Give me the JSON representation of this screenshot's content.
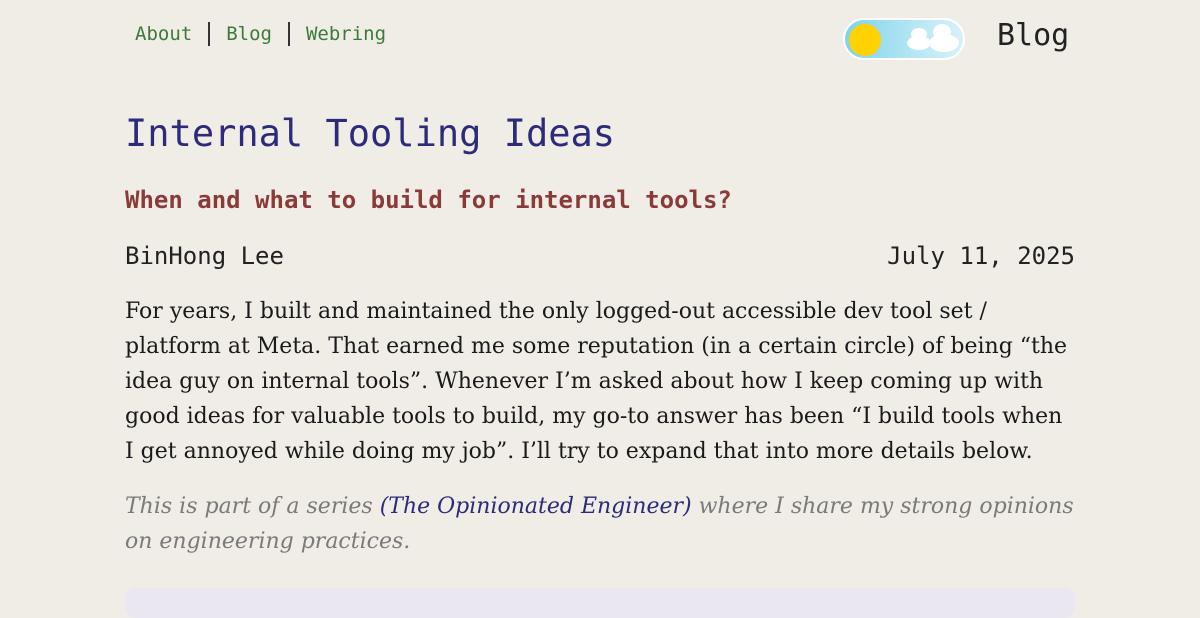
{
  "nav": {
    "items": [
      {
        "label": "About"
      },
      {
        "label": "Blog"
      },
      {
        "label": "Webring"
      }
    ]
  },
  "header": {
    "site_title": "Blog",
    "theme_toggle": {
      "state": "light",
      "icons": [
        "sun-icon",
        "cloud-icon"
      ]
    }
  },
  "post": {
    "title": "Internal Tooling Ideas",
    "subtitle": "When and what to build for internal tools?",
    "author": "BinHong Lee",
    "date": "July 11, 2025",
    "intro": "For years, I built and maintained the only logged-out accessible dev tool set / platform at Meta. That earned me some reputation (in a certain circle) of being “the idea guy on internal tools”. Whenever I’m asked about how I keep coming up with good ideas for valuable tools to build, my go-to answer has been “I build tools when I get annoyed while doing my job”. I’ll try to expand that into more details below.",
    "series_prefix": "This is part of a series ",
    "series_link": "(The Opinionated Engineer)",
    "series_suffix": " where I share my strong opinions on engineering practices."
  },
  "colors": {
    "background": "#f0ece6",
    "nav_link": "#3d7a3a",
    "title": "#2d2a7a",
    "subtitle": "#8b3a3a",
    "muted": "#7a7a7a"
  }
}
